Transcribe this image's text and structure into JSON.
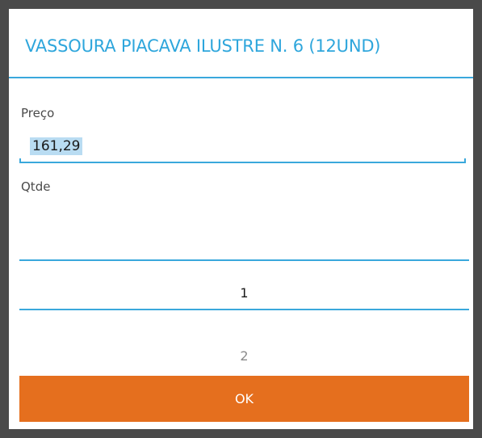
{
  "dialog": {
    "title": "VASSOURA PIACAVA ILUSTRE  N. 6 (12UND)"
  },
  "price": {
    "label": "Preço",
    "value": "161,29"
  },
  "quantity": {
    "label": "Qtde",
    "picker": {
      "selected": "1",
      "next": "2"
    }
  },
  "actions": {
    "ok_label": "OK"
  },
  "colors": {
    "accent": "#2ea6dc",
    "button": "#e56f1e",
    "selection_highlight": "#b9dcf2"
  }
}
